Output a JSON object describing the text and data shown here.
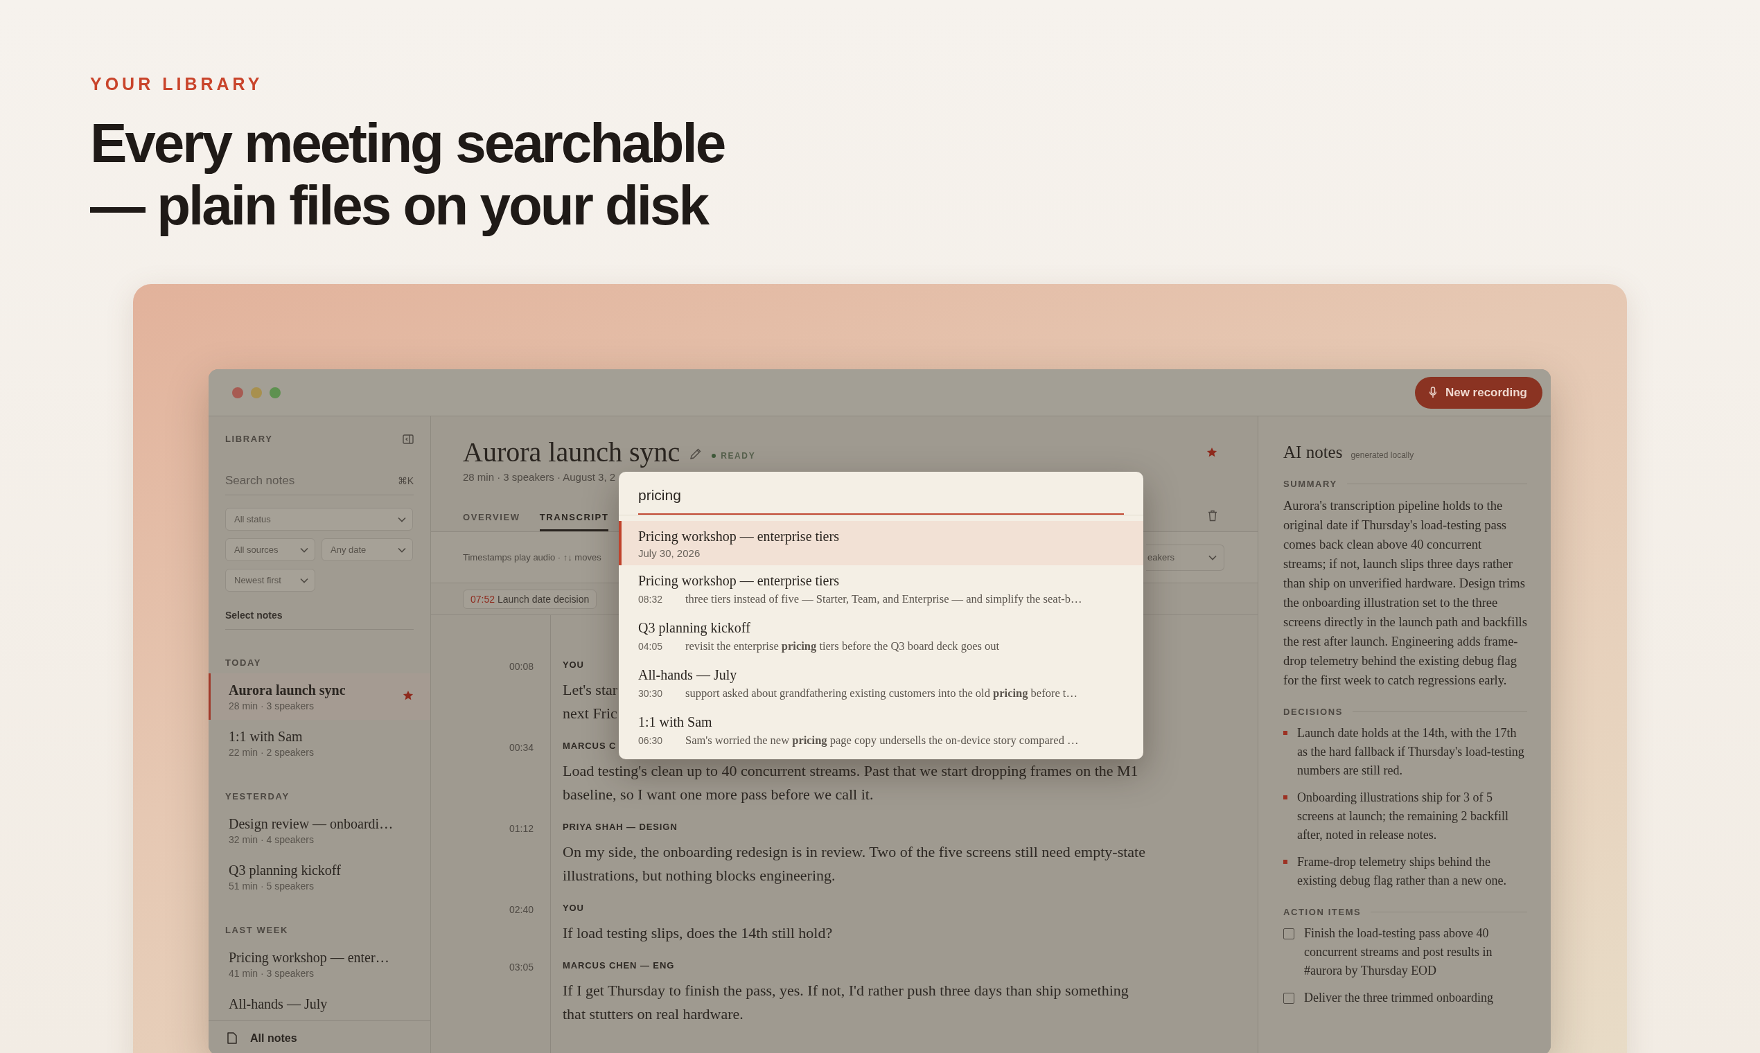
{
  "eyebrow": "YOUR LIBRARY",
  "headline": [
    "Every meeting searchable",
    "— plain files on your disk"
  ],
  "titlebar": {
    "new_recording": "New recording"
  },
  "sidebar": {
    "heading": "LIBRARY",
    "search": {
      "placeholder": "Search notes",
      "shortcut": "⌘K"
    },
    "filters": [
      {
        "label": "All status",
        "wide": true
      },
      {
        "label": "All sources",
        "wide": false
      },
      {
        "label": "Any date",
        "wide": false
      },
      {
        "label": "Newest first",
        "wide": false
      }
    ],
    "select_notes": "Select notes",
    "groups": [
      {
        "label": "TODAY",
        "notes": [
          {
            "title": "Aurora launch sync",
            "meta": "28 min · 3 speakers",
            "selected": true,
            "starred": true
          },
          {
            "title": "1:1 with Sam",
            "meta": "22 min · 2 speakers",
            "selected": false,
            "starred": false
          }
        ]
      },
      {
        "label": "YESTERDAY",
        "notes": [
          {
            "title": "Design review — onboardi…",
            "meta": "32 min · 4 speakers",
            "selected": false,
            "starred": false
          },
          {
            "title": "Q3 planning kickoff",
            "meta": "51 min · 5 speakers",
            "selected": false,
            "starred": false
          }
        ]
      },
      {
        "label": "LAST WEEK",
        "notes": [
          {
            "title": "Pricing workshop — enter…",
            "meta": "41 min · 3 speakers",
            "selected": false,
            "starred": false
          },
          {
            "title": "All-hands — July",
            "selected": false,
            "starred": false
          }
        ]
      }
    ],
    "footer": "All notes"
  },
  "note": {
    "title": "Aurora launch sync",
    "status": "READY",
    "meta": "28 min · 3 speakers · August 3, 2",
    "starred": true,
    "tabs": [
      {
        "label": "OVERVIEW",
        "selected": false
      },
      {
        "label": "TRANSCRIPT",
        "selected": true
      }
    ],
    "hint": "Timestamps play audio · ↑↓ moves",
    "speaker_filter": "eakers",
    "chapters": [
      {
        "time": "07:52",
        "label": "Launch date decision"
      }
    ],
    "transcript": [
      {
        "time": "00:08",
        "speaker": "YOU",
        "lines": [
          "Let's star",
          "next Fric"
        ]
      },
      {
        "time": "00:34",
        "speaker": "MARCUS C",
        "lines": [
          "Load testing's clean up to 40 concurrent streams. Past that we start dropping frames on the M1",
          "baseline, so I want one more pass before we call it."
        ]
      },
      {
        "time": "01:12",
        "speaker": "PRIYA SHAH — DESIGN",
        "lines": [
          "On my side, the onboarding redesign is in review. Two of the five screens still need empty-state",
          "illustrations, but nothing blocks engineering."
        ]
      },
      {
        "time": "02:40",
        "speaker": "YOU",
        "lines": [
          "If load testing slips, does the 14th still hold?"
        ]
      },
      {
        "time": "03:05",
        "speaker": "MARCUS CHEN — ENG",
        "lines": [
          "If I get Thursday to finish the pass, yes. If not, I'd rather push three days than ship something",
          "that stutters on real hardware."
        ]
      }
    ]
  },
  "search": {
    "query": "pricing",
    "results": [
      {
        "kind": "note",
        "title": "Pricing workshop — enterprise tiers",
        "date": "July 30, 2026",
        "selected": true
      },
      {
        "kind": "match",
        "title": "Pricing workshop — enterprise tiers",
        "time": "08:32",
        "snippet": "three tiers instead of five — Starter, Team, and Enterprise — and simplify the seat-b…",
        "selected": false
      },
      {
        "kind": "match",
        "title": "Q3 planning kickoff",
        "time": "04:05",
        "snippet": "revisit the enterprise **pricing** tiers before the Q3 board deck goes out",
        "selected": false
      },
      {
        "kind": "match",
        "title": "All-hands — July",
        "time": "30:30",
        "snippet": "support asked about grandfathering existing customers into the old **pricing** before t…",
        "selected": false
      },
      {
        "kind": "match",
        "title": "1:1 with Sam",
        "time": "06:30",
        "snippet": "Sam's worried the new **pricing** page copy undersells the on-device story compared …",
        "selected": false
      }
    ]
  },
  "ai_notes": {
    "title": "AI notes",
    "subtitle": "generated locally",
    "sections": [
      {
        "kind": "paragraph",
        "heading": "SUMMARY",
        "text": "Aurora's transcription pipeline holds to the original date if Thursday's load-testing pass comes back clean above 40 concurrent streams; if not, launch slips three days rather than ship on unverified hardware. Design trims the onboarding illustration set to the three screens directly in the launch path and backfills the rest after launch. Engineering adds frame-drop telemetry behind the existing debug flag for the first week to catch regressions early."
      },
      {
        "kind": "bullets",
        "heading": "DECISIONS",
        "items": [
          "Launch date holds at the 14th, with the 17th as the hard fallback if Thursday's load-testing numbers are still red.",
          "Onboarding illustrations ship for 3 of 5 screens at launch; the remaining 2 backfill after, noted in release notes.",
          "Frame-drop telemetry ships behind the existing debug flag rather than a new one."
        ]
      },
      {
        "kind": "checklist",
        "heading": "ACTION ITEMS",
        "items": [
          {
            "text": "Finish the load-testing pass above 40 concurrent streams and post results in #aurora by Thursday EOD",
            "checked": false
          },
          {
            "text": "Deliver the three trimmed onboarding",
            "checked": false
          }
        ]
      }
    ]
  }
}
